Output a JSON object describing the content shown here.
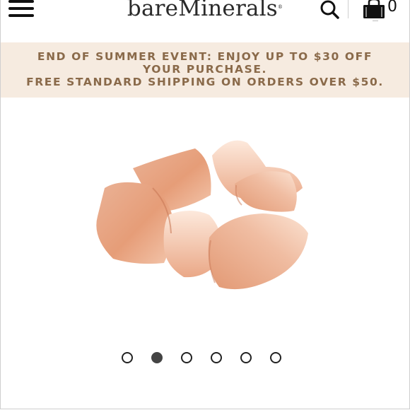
{
  "header": {
    "brand": "bareMinerals",
    "brand_mark": "®",
    "cart_count": "0",
    "icons": [
      "menu-icon",
      "search-icon",
      "shopping-bag-icon"
    ]
  },
  "promo": {
    "line1": "END OF SUMMER EVENT: ENJOY UP TO $30 OFF",
    "line2": "YOUR PURCHASE.",
    "line3": "FREE STANDARD SHIPPING ON ORDERS OVER $50."
  },
  "product": {
    "image": "product-image",
    "colors": {
      "base": "#e8a27e",
      "light": "#f9ddcb",
      "shadow": "#c97a57"
    }
  },
  "carousel": {
    "slide_count": 6,
    "active_index": 1
  },
  "colors": {
    "promo_background": "#f6ebe0",
    "promo_text": "#8a6a4a"
  }
}
